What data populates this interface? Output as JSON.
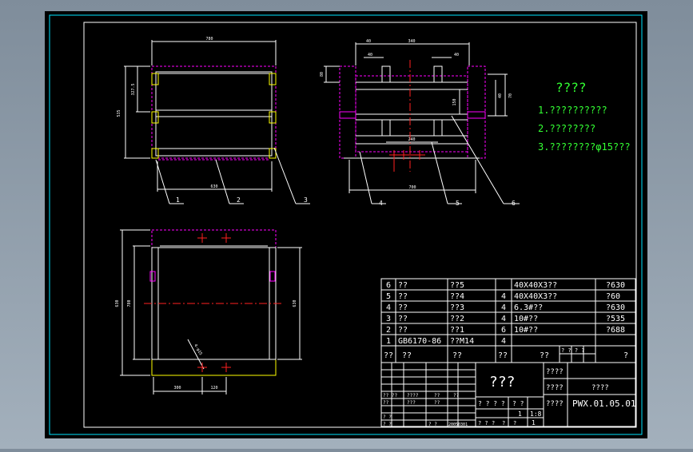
{
  "drawing": {
    "notes_title": "????",
    "notes": [
      "1.??????????",
      "2.????????",
      "3.????????φ15???"
    ]
  },
  "part_labels": [
    "1",
    "2",
    "3",
    "4",
    "5",
    "6"
  ],
  "dimensions": {
    "top_width": "780",
    "bottom_width": "630",
    "left_overall": "535",
    "left_partial": "327.5",
    "side_top_left": "40",
    "side_top_mid": "340",
    "side_sub_a": "40",
    "side_sub_b": "40",
    "side_inner": "150",
    "side_bottom_a": "240",
    "side_bottom": "700",
    "side_right_a": "40",
    "side_right_b": "70",
    "side_left": "80",
    "plan_left_outer": "630",
    "plan_left_inner": "780",
    "plan_right": "630",
    "plan_bottom_a": "300",
    "plan_bottom_b": "120",
    "plan_diag": "4-φ15"
  },
  "bom": {
    "rows": [
      {
        "no": "6",
        "code": "??",
        "name": "??5",
        "qty": "",
        "material": "40X40X3??",
        "note": "?630"
      },
      {
        "no": "5",
        "code": "??",
        "name": "??4",
        "qty": "4",
        "material": "40X40X3??",
        "note": "?60"
      },
      {
        "no": "4",
        "code": "??",
        "name": "??3",
        "qty": "4",
        "material": "6.3#??",
        "note": "?630"
      },
      {
        "no": "3",
        "code": "??",
        "name": "??2",
        "qty": "4",
        "material": "10#??",
        "note": "?535"
      },
      {
        "no": "2",
        "code": "??",
        "name": "??1",
        "qty": "6",
        "material": "10#??",
        "note": "?688"
      },
      {
        "no": "1",
        "code": "GB6170-86",
        "name": "??M14",
        "qty": "4",
        "material": "",
        "note": ""
      }
    ],
    "header": {
      "no": "??",
      "code": "??",
      "name": "??",
      "qty": "??",
      "material": "??",
      "weight": "? ? ? ?",
      "note": "?"
    }
  },
  "title_block": {
    "part_name": "???",
    "label_a": "????",
    "label_b": "????",
    "label_c": "????",
    "material_value": "????",
    "drawing_no": "PWX.01.05.01",
    "scale": "1:8",
    "sheet_a": "1",
    "sheet_b": "1",
    "stage": "? ? ? ?",
    "mass": "? ?",
    "cell_a": "?? ??",
    "cell_b": "????",
    "cell_c": "??",
    "cell_d": "??",
    "cell_e": "???",
    "cell_f": "??",
    "cell_g": "??",
    "cell_h": "? ?",
    "cell_i": "? ?",
    "cell_j": "20050301",
    "cell_k": "? ?",
    "cell_l": "? ?",
    "cell_m": "?",
    "cell_n": "?",
    "cell_o": "?"
  },
  "colors": {
    "background": "#000000",
    "frame": "#ffffff",
    "outer_frame": "#00e5ff",
    "part_outline": "#ffffff",
    "hidden": "#ff00ff",
    "dimension": "#ffffff",
    "centerline": "#ff2020",
    "highlight": "#ffff00",
    "table": "#ffffff",
    "table_text": "#ffffff",
    "notes": "#33ff33"
  }
}
